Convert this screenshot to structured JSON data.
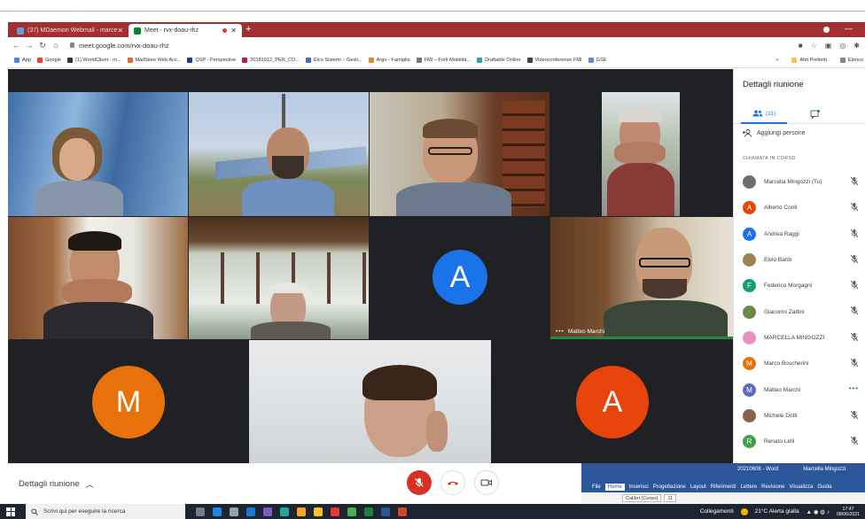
{
  "browser": {
    "tabs": [
      {
        "title": "(37) MDaemon Webmail - marce",
        "active": false
      },
      {
        "title": "Meet - rvx-doau-rhz",
        "active": true
      }
    ],
    "url": "meet.google.com/rvx-doau-rhz",
    "bookmarks": [
      "App",
      "Google",
      "(1) WorldClient - m...",
      "MailStore Web Acc...",
      "QSP - Perspective",
      "20181012_PER_CO...",
      "Elco Sistemi :: Gesti...",
      "Argo - Famiglia",
      "FMI – Forlì Mobilità...",
      "Draftable Online",
      "Videoconferenze FMI",
      "GSE"
    ],
    "bookmarks_right": [
      "Altri Preferiti",
      "Elenco"
    ]
  },
  "meet": {
    "tile_avatars": [
      {
        "letter": "A",
        "color": "#1a73e8"
      },
      {
        "letter": "M",
        "color": "#e8710a"
      },
      {
        "letter": "A",
        "color": "#e8430a"
      }
    ],
    "speaker_name": "Matteo Marchi",
    "controls": {
      "details_label": "Dettagli riunione"
    }
  },
  "panel": {
    "title": "Dettagli riunione",
    "people_count": "(11)",
    "add_people": "Aggiungi persone",
    "section": "CHIAMATA IN CORSO",
    "participants": [
      {
        "name": "Marcella Mingozzi (Tu)",
        "letter": "",
        "color": "#6d6d6d"
      },
      {
        "name": "Alberto Conti",
        "letter": "A",
        "color": "#e8430a"
      },
      {
        "name": "Andrea Raggi",
        "letter": "A",
        "color": "#1a73e8"
      },
      {
        "name": "Elvio Bardi",
        "letter": "",
        "color": "#a08050"
      },
      {
        "name": "Federico Morgagni",
        "letter": "F",
        "color": "#129e73"
      },
      {
        "name": "Giacomo Zattini",
        "letter": "",
        "color": "#6a8a4a"
      },
      {
        "name": "MARCELLA MINGOZZI",
        "letter": "",
        "color": "#e890c0"
      },
      {
        "name": "Marco Boscherini",
        "letter": "M",
        "color": "#e8710a"
      },
      {
        "name": "Matteo Marchi",
        "letter": "M",
        "color": "#5c6bc0"
      },
      {
        "name": "Michele Dotti",
        "letter": "",
        "color": "#8a6048"
      },
      {
        "name": "Renato Lelli",
        "letter": "R",
        "color": "#43a047"
      }
    ]
  },
  "word": {
    "file": "20210608 - Word",
    "user": "Marcella Mingozzi",
    "tabs": [
      "File",
      "Home",
      "Inserisci",
      "Progettazione",
      "Layout",
      "Riferimenti",
      "Lettere",
      "Revisione",
      "Visualizza",
      "Guida"
    ],
    "font": "Calibri (Corpo)",
    "size": "11"
  },
  "taskbar": {
    "search_placeholder": "Scrivi qui per eseguire la ricerca",
    "network": "Collegamenti",
    "weather": "21°C  Alerta gialla",
    "time": "17:47",
    "date": "08/06/2021"
  }
}
